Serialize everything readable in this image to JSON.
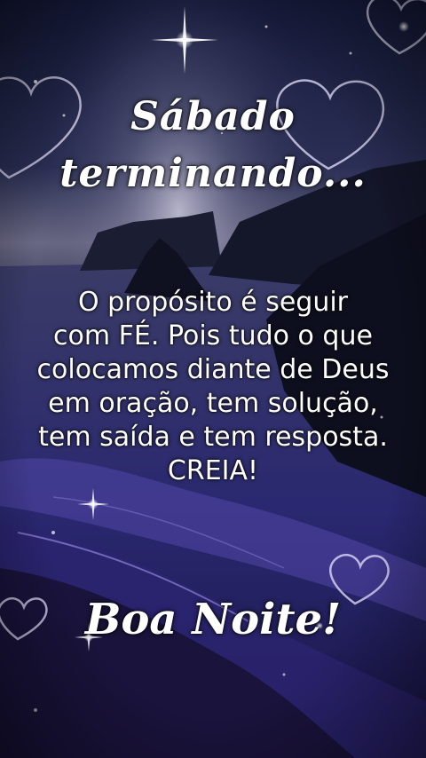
{
  "greeting": {
    "line1": "Sábado",
    "line2": "terminando..."
  },
  "message": {
    "lines": [
      "O propósito é seguir",
      "com FÉ. Pois tudo o que",
      "colocamos diante de Deus",
      "em oração, tem solução,",
      "tem saída e tem resposta.",
      "CREIA!"
    ]
  },
  "closing": "Boa Noite!",
  "colors": {
    "sky_top": "#1a1f45",
    "sky_mid": "#3a3d63",
    "sea": "#2a2a6e",
    "wave": "#5a4bb5",
    "heart_outline": "#e8e4ff",
    "text": "#ffffff"
  }
}
